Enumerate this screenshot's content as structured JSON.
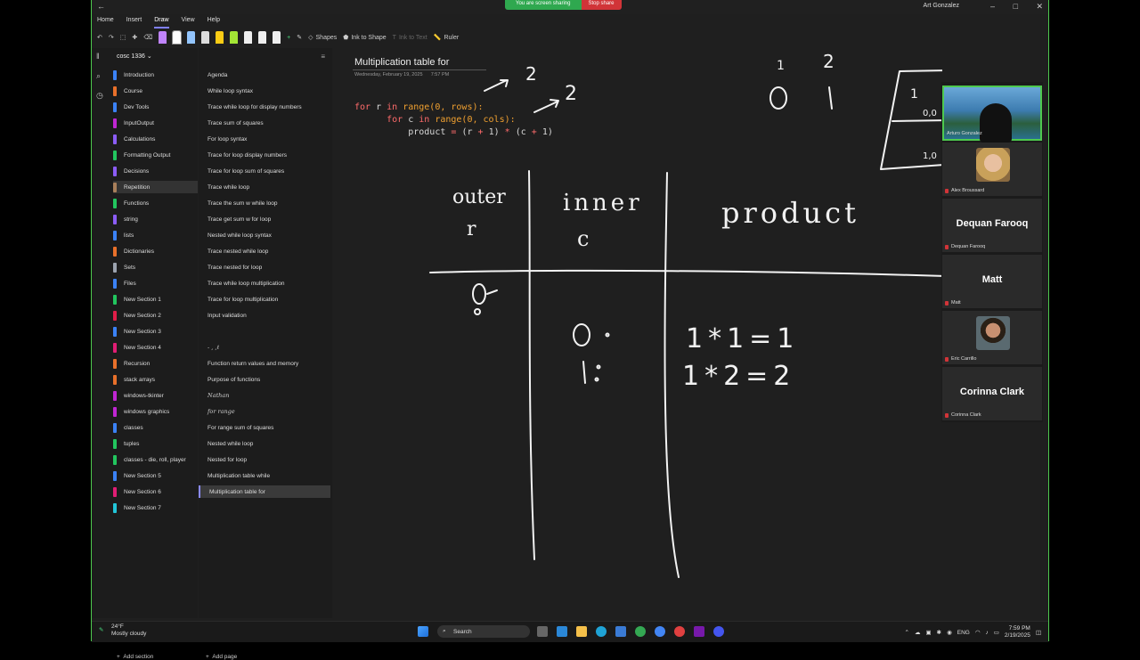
{
  "share_banner": {
    "message": "You are screen sharing",
    "stop": "Stop share"
  },
  "user": {
    "name": "Art Gonzalez"
  },
  "menu": [
    "Home",
    "Insert",
    "Draw",
    "View",
    "Help"
  ],
  "ribbon": {
    "shapes": "Shapes",
    "ink_to_shape": "Ink to Shape",
    "ink_to_text": "Ink to Text",
    "ruler": "Ruler"
  },
  "notebook": {
    "name": "cosc 1336"
  },
  "sections": [
    {
      "label": "Introduction",
      "color": "#3b82f6"
    },
    {
      "label": "Course",
      "color": "#e8702a"
    },
    {
      "label": "Dev Tools",
      "color": "#3b82f6"
    },
    {
      "label": "InputOutput",
      "color": "#c026d3"
    },
    {
      "label": "Calculations",
      "color": "#8b5cf6"
    },
    {
      "label": "Formatting Output",
      "color": "#22c55e"
    },
    {
      "label": "Decisions",
      "color": "#8b5cf6"
    },
    {
      "label": "Repetition",
      "color": "#a87f5a"
    },
    {
      "label": "Functions",
      "color": "#22c55e"
    },
    {
      "label": "string",
      "color": "#8b5cf6"
    },
    {
      "label": "lists",
      "color": "#3b82f6"
    },
    {
      "label": "Dictionaries",
      "color": "#e8702a"
    },
    {
      "label": "Sets",
      "color": "#9ca3af"
    },
    {
      "label": "Files",
      "color": "#3b82f6"
    },
    {
      "label": "New Section 1",
      "color": "#22c55e"
    },
    {
      "label": "New Section 2",
      "color": "#e11d48"
    },
    {
      "label": "New Section 3",
      "color": "#3b82f6"
    },
    {
      "label": "New Section 4",
      "color": "#e11d74"
    },
    {
      "label": "Recursion",
      "color": "#e8702a"
    },
    {
      "label": "stack arrays",
      "color": "#e8702a"
    },
    {
      "label": "windows-tkinter",
      "color": "#c026d3"
    },
    {
      "label": "windows graphics",
      "color": "#c026d3"
    },
    {
      "label": "classes",
      "color": "#3b82f6"
    },
    {
      "label": "tuples",
      "color": "#22c55e"
    },
    {
      "label": "classes - die, roll, player",
      "color": "#22c55e"
    },
    {
      "label": "New Section 5",
      "color": "#3b82f6"
    },
    {
      "label": "New Section 6",
      "color": "#e11d74"
    },
    {
      "label": "New Section 7",
      "color": "#22c5d8"
    }
  ],
  "selected_section": 7,
  "add_section": "Add section",
  "pages": [
    {
      "label": "Agenda",
      "ink": false
    },
    {
      "label": "While loop syntax",
      "ink": false
    },
    {
      "label": "Trace while loop for display numbers",
      "ink": false
    },
    {
      "label": "Trace sum of squares",
      "ink": false
    },
    {
      "label": "For loop syntax",
      "ink": false
    },
    {
      "label": "Trace for loop display numbers",
      "ink": false
    },
    {
      "label": "Trace for loop sum of squares",
      "ink": false
    },
    {
      "label": "Trace while loop",
      "ink": false
    },
    {
      "label": "Trace the sum w while loop",
      "ink": false
    },
    {
      "label": "Trace get sum w for loop",
      "ink": false
    },
    {
      "label": "Nested while loop syntax",
      "ink": false
    },
    {
      "label": "Trace nested while loop",
      "ink": false
    },
    {
      "label": "Trace nested for loop",
      "ink": false
    },
    {
      "label": "Trace while loop multiplication",
      "ink": false
    },
    {
      "label": "Trace for loop multiplication",
      "ink": false
    },
    {
      "label": "Input validation",
      "ink": false
    },
    {
      "label": "",
      "ink": false
    },
    {
      "label": "- ,  ,ℓ",
      "ink": true
    },
    {
      "label": "Function return values and memory",
      "ink": false
    },
    {
      "label": "Purpose of functions",
      "ink": false
    },
    {
      "label": "Nathan",
      "ink": true
    },
    {
      "label": "for range",
      "ink": true
    },
    {
      "label": "For range sum of squares",
      "ink": false
    },
    {
      "label": "Nested while loop",
      "ink": false
    },
    {
      "label": "Nested for loop",
      "ink": false
    },
    {
      "label": "Multiplication table while",
      "ink": false
    },
    {
      "label": "Multiplication table for",
      "ink": false
    }
  ],
  "selected_page": 26,
  "add_page": "Add page",
  "page": {
    "title": "Multiplication table for",
    "date": "Wednesday, February 19, 2025",
    "time": "7:57 PM",
    "code": {
      "l1_kw": "for",
      "l1_var": " r ",
      "l1_in": "in",
      "l1_rest": " range(0, rows):",
      "l2_kw": "for",
      "l2_var": " c ",
      "l2_in": "in",
      "l2_rest": " range(0, cols):",
      "l3_a": "product ",
      "l3_eq": "=",
      "l3_b": " (r ",
      "l3_plus1": "+",
      "l3_c": " 1) ",
      "l3_mul": "*",
      "l3_d": " (c ",
      "l3_plus2": "+",
      "l3_e": " 1)"
    }
  },
  "participants": [
    {
      "name": "Arturo Gonzalez",
      "kind": "video"
    },
    {
      "name": "Alex Broussard",
      "kind": "photo"
    },
    {
      "name": "Dequan Farooq",
      "kind": "initials",
      "big": "Dequan Farooq"
    },
    {
      "name": "Matt",
      "kind": "initials",
      "big": "Matt"
    },
    {
      "name": "Eric Carrillo",
      "kind": "photo"
    },
    {
      "name": "Corinna Clark",
      "kind": "initials",
      "big": "Corinna Clark"
    }
  ],
  "taskbar": {
    "temp": "24°F",
    "weather": "Mostly cloudy",
    "search": "Search",
    "lang": "ENG",
    "time": "7:59 PM",
    "date": "2/19/2025"
  }
}
